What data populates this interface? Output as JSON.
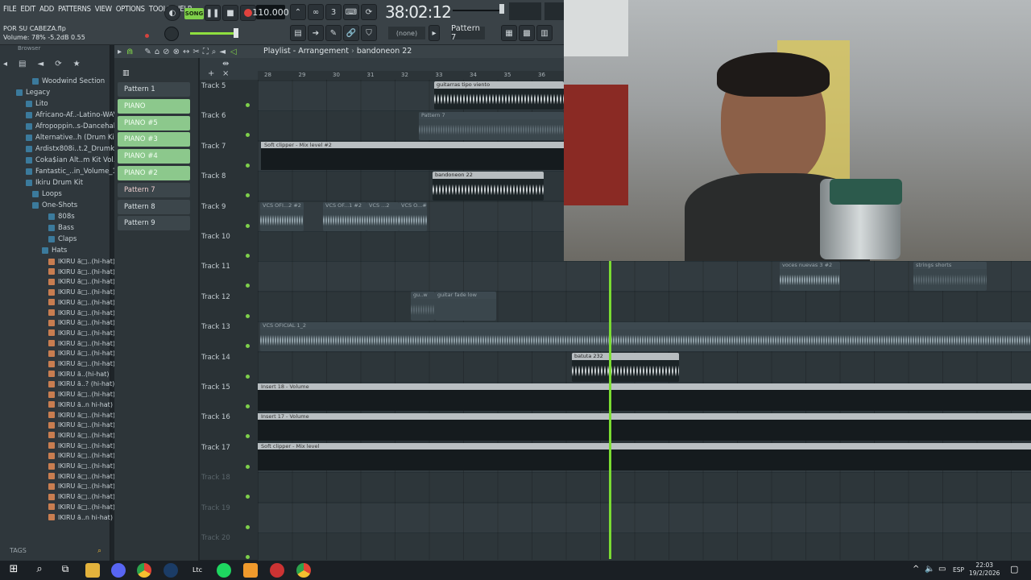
{
  "menu": [
    "FILE",
    "EDIT",
    "ADD",
    "PATTERNS",
    "VIEW",
    "OPTIONS",
    "TOOLS",
    "HELP"
  ],
  "transport": {
    "song_label": "SONG",
    "tempo": "110.000",
    "time": "38:02:12"
  },
  "project": {
    "filename": "POR SU CABEZA.flp",
    "volume_line": "Volume: 78%  -5.2dB  0.55"
  },
  "pattern_selector": {
    "none_label": "(none)",
    "current": "Pattern 7"
  },
  "browser": {
    "header": "Browser",
    "items": [
      "Woodwind Section",
      "Legacy",
      "Lito",
      "Africano-Af..-Latino-WAV",
      "Afropoppin..s-Dancehall",
      "Alternative..h (Drum Kit)",
      "Ardistx808i..t.2_Drumkit",
      "Coka$ian Alt..m Kit Vol.2",
      "Fantastic_..in_Volume_1",
      "Ikiru Drum Kit",
      "Loops",
      "One-Shots",
      "808s",
      "Bass",
      "Claps",
      "Hats"
    ],
    "files": [
      "IKIRU ã□..(hi-hat)",
      "IKIRU ã□..(hi-hat)",
      "IKIRU ã□..(hi-hat)",
      "IKIRU ã□..(hi-hat)",
      "IKIRU ã□..(hi-hat)",
      "IKIRU ã□..(hi-hat)",
      "IKIRU ã□..(hi-hat)",
      "IKIRU ã□..(hi-hat)",
      "IKIRU ã□..(hi-hat)",
      "IKIRU ã□..(hi-hat)",
      "IKIRU ã□..(hi-hat)",
      "IKIRU ã..(hi-hat)",
      "IKIRU ã..? (hi-hat)",
      "IKIRU ã□..(hi-hat)",
      "IKIRU ã..n hi-hat)",
      "IKIRU ã□..(hi-hat)",
      "IKIRU ã□..(hi-hat)",
      "IKIRU ã□..(hi-hat)",
      "IKIRU ã□..(hi-hat)",
      "IKIRU ã□..(hi-hat)",
      "IKIRU ã□..(hi-hat)",
      "IKIRU ã□..(hi-hat)",
      "IKIRU ã□..(hi-hat)",
      "IKIRU ã□..(hi-hat)",
      "IKIRU ã□..(hi-hat)",
      "IKIRU ã..n hi-hat)"
    ],
    "tags_label": "TAGS"
  },
  "channels": [
    "Pattern 1",
    "PIANO",
    "PIANO #5",
    "PIANO #3",
    "PIANO #4",
    "PIANO #2",
    "Pattern 7",
    "Pattern 8",
    "Pattern 9"
  ],
  "playlist": {
    "title": "Playlist - Arrangement",
    "breadcrumb": "bandoneon 22",
    "ruler": [
      "28",
      "29",
      "30",
      "31",
      "32",
      "33",
      "34",
      "35",
      "36"
    ]
  },
  "tracks": [
    "Track 5",
    "Track 6",
    "Track 7",
    "Track 8",
    "Track 9",
    "Track 10",
    "Track 11",
    "Track 12",
    "Track 13",
    "Track 14",
    "Track 15",
    "Track 16",
    "Track 17",
    "Track 18",
    "Track 19",
    "Track 20"
  ],
  "clips": {
    "guitarras": "guitarras tipo viento",
    "pattern7": "Pattern 7",
    "softclip2": "Soft clipper - Mix level #2",
    "bandoneon": "bandoneon 22",
    "vcs1": "VCS OFI...2 #2",
    "vcs2": "VCS OF...1 #2",
    "vcs3": "VCS ...2",
    "vcs4": "VCS O...#3",
    "voces": "voces nuevas 3 #2",
    "strings": "strings shorts",
    "guitarfade": "guitar fade low",
    "guitarfade_small": "gu..w",
    "vcsoficial": "VCS OFICIAL 1_2",
    "batuta": "batuta 232",
    "insert18": "Insert 18 - Volume",
    "insert17": "Insert 17 - Volume",
    "softclip": "Soft clipper - Mix level"
  },
  "taskbar": {
    "lang": "ESP",
    "time": "22:03",
    "date": "19/2/2026"
  }
}
